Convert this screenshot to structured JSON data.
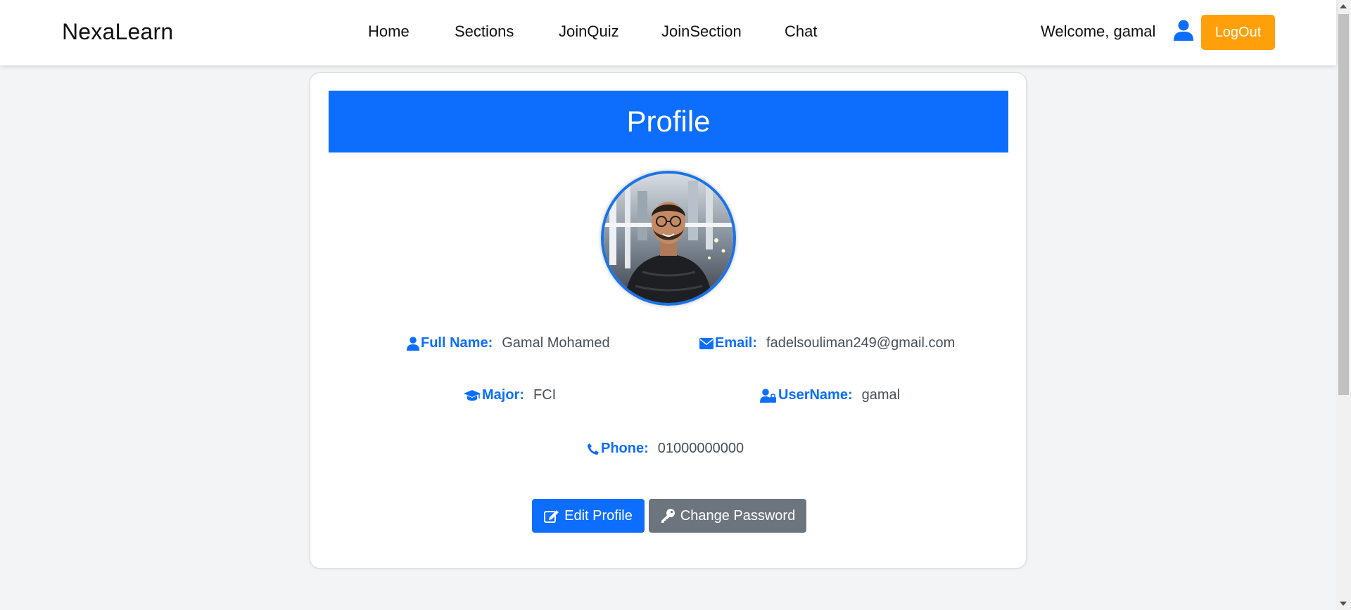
{
  "navbar": {
    "brand": "NexaLearn",
    "links": [
      "Home",
      "Sections",
      "JoinQuiz",
      "JoinSection",
      "Chat"
    ],
    "welcome": "Welcome, gamal",
    "user_icon": "user-icon",
    "logout_label": "LogOut"
  },
  "profile": {
    "title": "Profile",
    "fields": {
      "full_name": {
        "label": "Full Name:",
        "value": "Gamal Mohamed",
        "icon": "user-icon"
      },
      "email": {
        "label": "Email:",
        "value": "fadelsouliman249@gmail.com",
        "icon": "envelope-icon"
      },
      "major": {
        "label": "Major:",
        "value": "FCI",
        "icon": "graduation-cap-icon"
      },
      "username": {
        "label": "UserName:",
        "value": "gamal",
        "icon": "user-lock-icon"
      },
      "phone": {
        "label": "Phone:",
        "value": "01000000000",
        "icon": "phone-icon"
      }
    },
    "buttons": {
      "edit": "Edit Profile",
      "change_password": "Change Password"
    }
  },
  "colors": {
    "primary": "#0d6efd",
    "logout": "#ff9f0a",
    "secondary": "#6c757d",
    "page_bg": "#f3f4f6"
  }
}
